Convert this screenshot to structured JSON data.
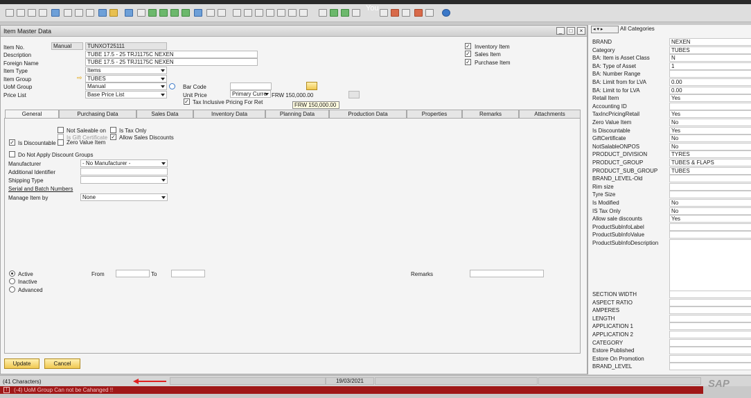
{
  "overlay_name": "You",
  "window": {
    "title": "Item Master Data"
  },
  "header": {
    "item_no_label": "Item No.",
    "series": "Manual",
    "item_no": "TUNXOT25111",
    "description_label": "Description",
    "description": "TUBE 17.5 - 25 TRJ1175C NEXEN",
    "foreign_name_label": "Foreign Name",
    "foreign_name": "TUBE 17.5 - 25 TRJ1175C NEXEN",
    "item_type_label": "Item Type",
    "item_type": "Items",
    "item_group_label": "Item Group",
    "item_group": "TUBES",
    "uom_group_label": "UoM Group",
    "uom_group": "Manual",
    "price_list_label": "Price List",
    "price_list": "Base Price List",
    "bar_code_label": "Bar Code",
    "unit_price_label": "Unit Price",
    "currency": "Primary Curre",
    "unit_price": "FRW 150,000.00",
    "tax_inclusive_label": "Tax Inclusive Pricing For Ret",
    "tooltip_price": "FRW 150,000.00",
    "inventory_item_label": "Inventory Item",
    "sales_item_label": "Sales Item",
    "purchase_item_label": "Purchase Item"
  },
  "tabs": [
    "General",
    "Purchasing Data",
    "Sales Data",
    "Inventory Data",
    "Planning Data",
    "Production Data",
    "Properties",
    "Remarks",
    "Attachments"
  ],
  "general": {
    "not_saleable_label": "Not Saleable on",
    "tax_only_label": "Is Tax Only",
    "gift_cert_label": "Is Gift Certificate",
    "allow_sales_discounts_label": "Allow Sales Discounts",
    "is_discountable_label": "Is Discountable",
    "zero_value_label": "Zero Value Item",
    "no_discount_groups_label": "Do Not Apply Discount Groups",
    "manufacturer_label": "Manufacturer",
    "manufacturer": "- No Manufacturer -",
    "additional_identifier_label": "Additional Identifier",
    "shipping_type_label": "Shipping Type",
    "serial_batch_label": "Serial and Batch Numbers",
    "manage_by_label": "Manage Item by",
    "manage_by": "None",
    "active_label": "Active",
    "inactive_label": "Inactive",
    "advanced_label": "Advanced",
    "from_label": "From",
    "to_label": "To",
    "remarks_label": "Remarks"
  },
  "buttons": {
    "update": "Update",
    "cancel": "Cancel"
  },
  "udf": {
    "category_filter": "All Categories",
    "rows": [
      {
        "label": "BRAND",
        "value": "NEXEN"
      },
      {
        "label": "Category",
        "value": "TUBES"
      },
      {
        "label": "BA: Item is Asset Class",
        "value": "N"
      },
      {
        "label": "BA: Type of Asset",
        "value": "1"
      },
      {
        "label": "BA: Number Range",
        "value": ""
      },
      {
        "label": "BA: Limit from for LVA",
        "value": "0.00"
      },
      {
        "label": "BA: Limit to for LVA",
        "value": "0.00"
      },
      {
        "label": "Retail Item",
        "value": "Yes"
      },
      {
        "label": "Accounting ID",
        "value": ""
      },
      {
        "label": "TaxIncPricingRetail",
        "value": "Yes"
      },
      {
        "label": "Zero Value Item",
        "value": "No"
      },
      {
        "label": "Is Discountable",
        "value": "Yes"
      },
      {
        "label": "GiftCertificate",
        "value": "No"
      },
      {
        "label": "NotSalableONPOS",
        "value": "No"
      },
      {
        "label": "PRODUCT_DIVISION",
        "value": "TYRES"
      },
      {
        "label": "PRODUCT_GROUP",
        "value": "TUBES & FLAPS"
      },
      {
        "label": "PRODUCT_SUB_GROUP",
        "value": "TUBES"
      },
      {
        "label": "BRAND_LEVEL-Old",
        "value": ""
      },
      {
        "label": "Rim size",
        "value": ""
      },
      {
        "label": "Tyre Size",
        "value": ""
      },
      {
        "label": "Is Modified",
        "value": "No"
      },
      {
        "label": "IS Tax Only",
        "value": "No"
      },
      {
        "label": "Allow sale discounts",
        "value": "Yes"
      },
      {
        "label": "ProductSubInfoLabel",
        "value": ""
      },
      {
        "label": "ProductSubInfoValue",
        "value": ""
      }
    ],
    "description_label": "ProductSubInfoDescription",
    "rows2": [
      {
        "label": "SECTION WIDTH",
        "value": ""
      },
      {
        "label": "ASPECT RATIO",
        "value": ""
      },
      {
        "label": "AMPERES",
        "value": ""
      },
      {
        "label": "LENGTH",
        "value": ""
      },
      {
        "label": "APPLICATION 1",
        "value": ""
      },
      {
        "label": "APPLICATION 2",
        "value": ""
      },
      {
        "label": "CATEGORY",
        "value": ""
      },
      {
        "label": "Estore Published",
        "value": ""
      },
      {
        "label": "Estore On Promotion",
        "value": ""
      },
      {
        "label": "BRAND_LEVEL",
        "value": ""
      }
    ]
  },
  "status": {
    "characters": "(41 Characters)",
    "date": "19/03/2021",
    "error": "(-4) UoM Group Can not be Cahanged !!",
    "brand": "SAP"
  },
  "colors": {
    "error_bar": "#a01818",
    "button_yellow": "#f0c850",
    "annotation_arrow": "#e02020"
  }
}
